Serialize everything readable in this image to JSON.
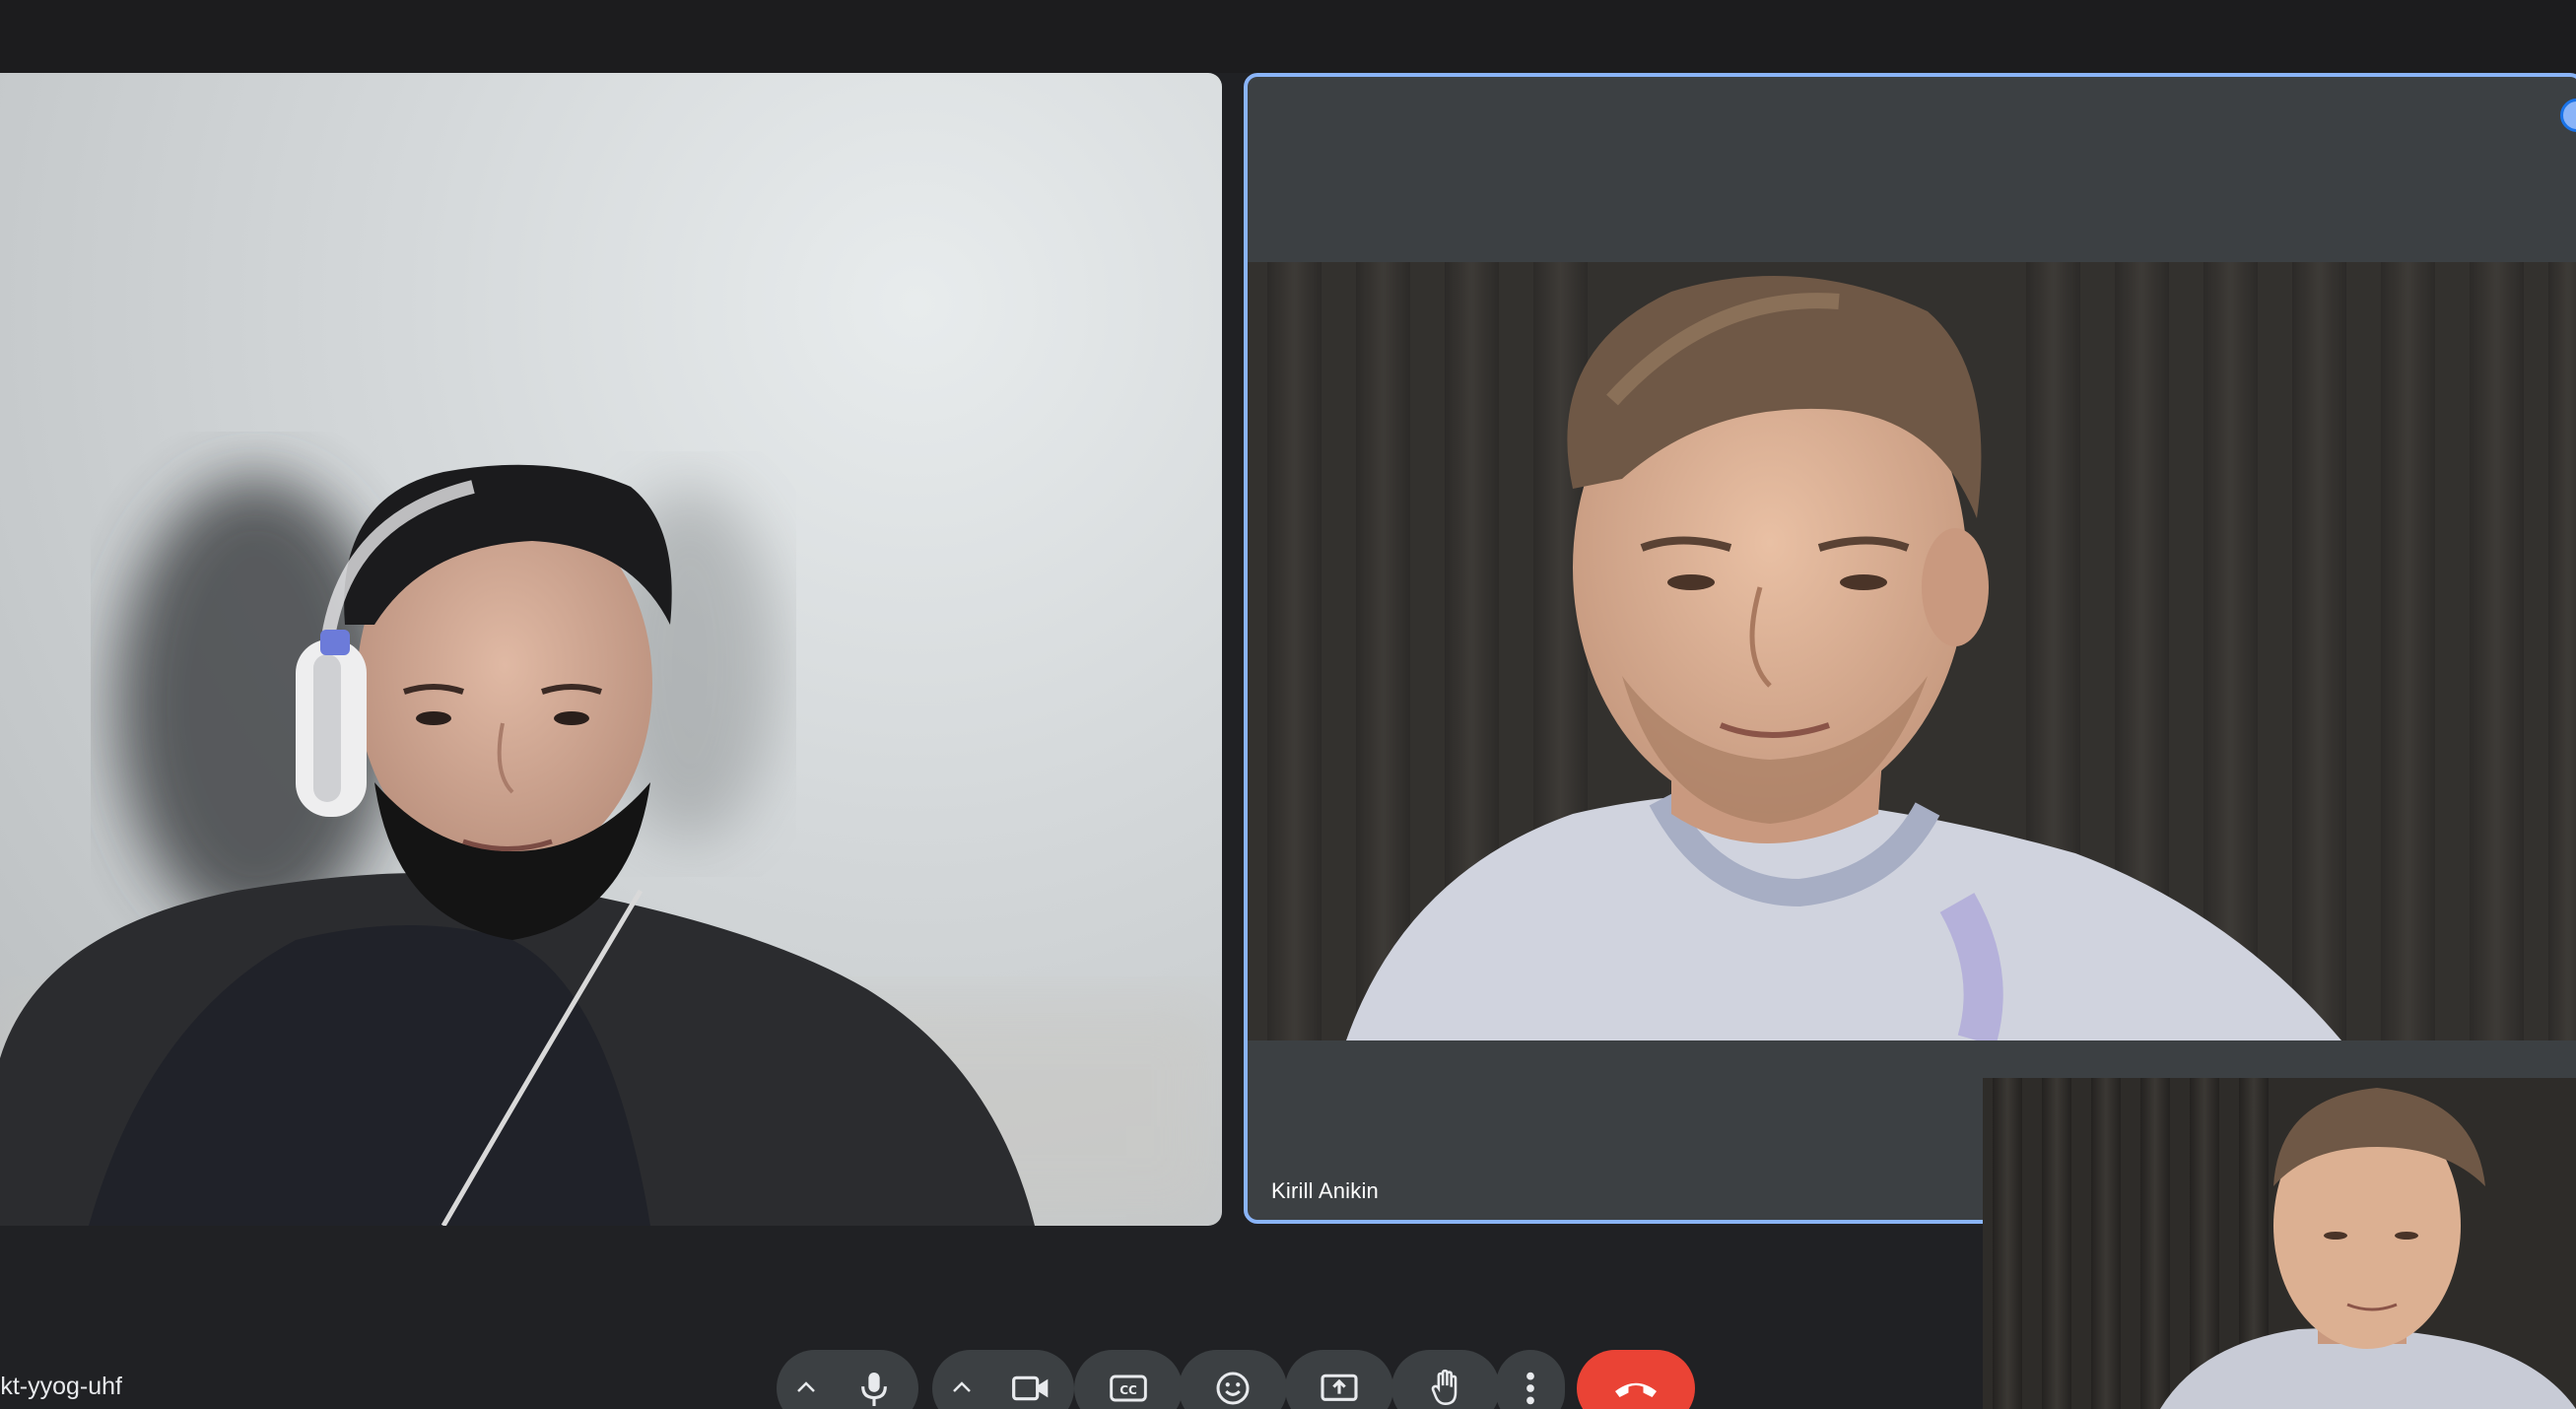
{
  "meeting": {
    "code_visible": "rkt-yyog-uhf"
  },
  "participants": {
    "left_tile": {
      "name": ""
    },
    "right_tile": {
      "name": "Kirill Anikin",
      "active_speaker": true
    }
  },
  "controls": {
    "mic_menu_icon": "chevron-up-icon",
    "mic_icon": "microphone-icon",
    "camera_menu_icon": "chevron-up-icon",
    "camera_icon": "video-camera-icon",
    "captions_icon": "closed-captions-icon",
    "reactions_icon": "emoji-icon",
    "present_icon": "present-screen-icon",
    "raise_hand_icon": "hand-icon",
    "more_icon": "more-vertical-icon",
    "leave_icon": "hang-up-icon"
  },
  "colors": {
    "background": "#202124",
    "tile_background": "#3c4043",
    "active_border": "#8ab4f8",
    "end_call": "#ea4335"
  }
}
